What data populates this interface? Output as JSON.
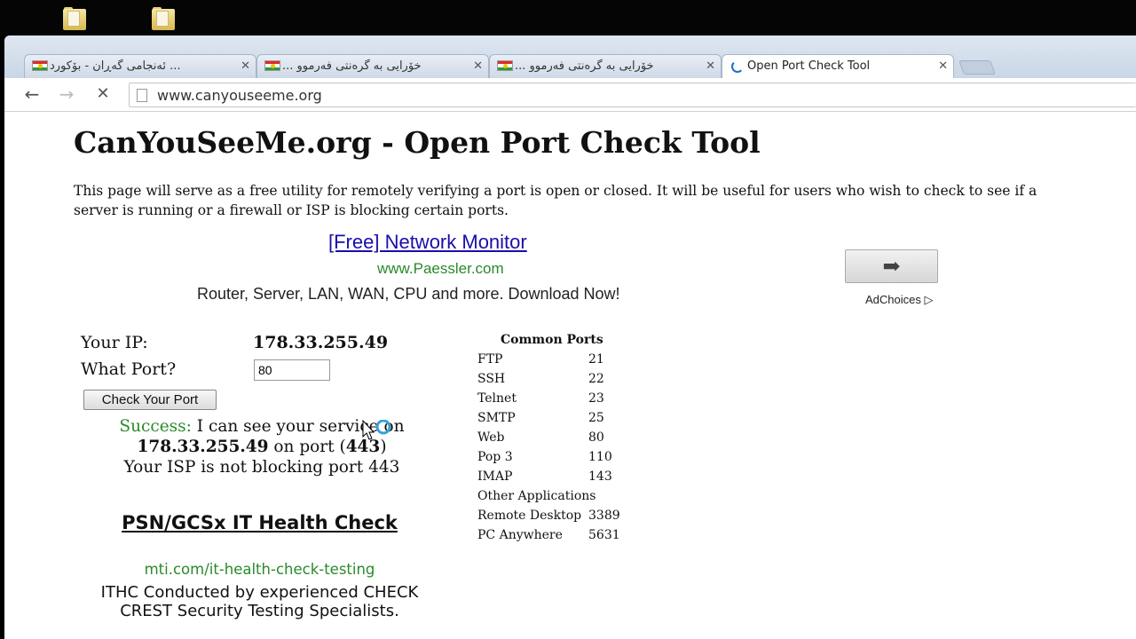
{
  "browser": {
    "tabs": [
      {
        "label": "ئەنجامی گەڕان - بۆکورد ..."
      },
      {
        "label": "... خۆرایی بە گرەنتی فەرموو"
      },
      {
        "label": "... خۆرایی بە گرەنتی فەرموو"
      },
      {
        "label": "Open Port Check Tool"
      }
    ],
    "url": "www.canyouseeme.org"
  },
  "page": {
    "title": "CanYouSeeMe.org - Open Port Check Tool",
    "intro": "This page will serve as a free utility for remotely verifying a port is open or closed. It will be useful for users who wish to check to see if a server is running or a firewall or ISP is blocking certain ports.",
    "ad1": {
      "title": "[Free] Network Monitor",
      "url": "www.Paessler.com",
      "desc": "Router, Server, LAN, WAN, CPU and more. Download Now!",
      "adchoices": "AdChoices"
    },
    "form": {
      "ip_label": "Your IP:",
      "ip_value": "178.33.255.49",
      "port_label": "What Port?",
      "port_value": "80",
      "button": "Check Your Port"
    },
    "result": {
      "success_word": "Success:",
      "line1": " I can see your service on",
      "ip": "178.33.255.49",
      "on_port": " on port (",
      "port": "443",
      "close_paren": ")",
      "line3": "Your ISP is not blocking port 443"
    },
    "ad2": {
      "title": "PSN/GCSx IT Health Check",
      "url": "mti.com/it-health-check-testing",
      "desc": "ITHC Conducted by experienced CHECK CREST Security Testing Specialists."
    },
    "common_ports": {
      "heading": "Common Ports",
      "rows": [
        {
          "name": "FTP",
          "port": "21"
        },
        {
          "name": "SSH",
          "port": "22"
        },
        {
          "name": "Telnet",
          "port": "23"
        },
        {
          "name": "SMTP",
          "port": "25"
        },
        {
          "name": "Web",
          "port": "80"
        },
        {
          "name": "Pop 3",
          "port": "110"
        },
        {
          "name": "IMAP",
          "port": "143"
        },
        {
          "name": "Other Applications",
          "port": ""
        },
        {
          "name": "Remote Desktop",
          "port": "3389"
        },
        {
          "name": "PC Anywhere",
          "port": "5631"
        }
      ]
    }
  },
  "icons": {
    "back": "back-arrow-icon",
    "forward": "forward-arrow-icon",
    "stop": "stop-icon",
    "page": "page-icon",
    "flag": "kurdistan-flag-icon",
    "spinner": "loading-spinner-icon",
    "folder": "folder-icon"
  }
}
